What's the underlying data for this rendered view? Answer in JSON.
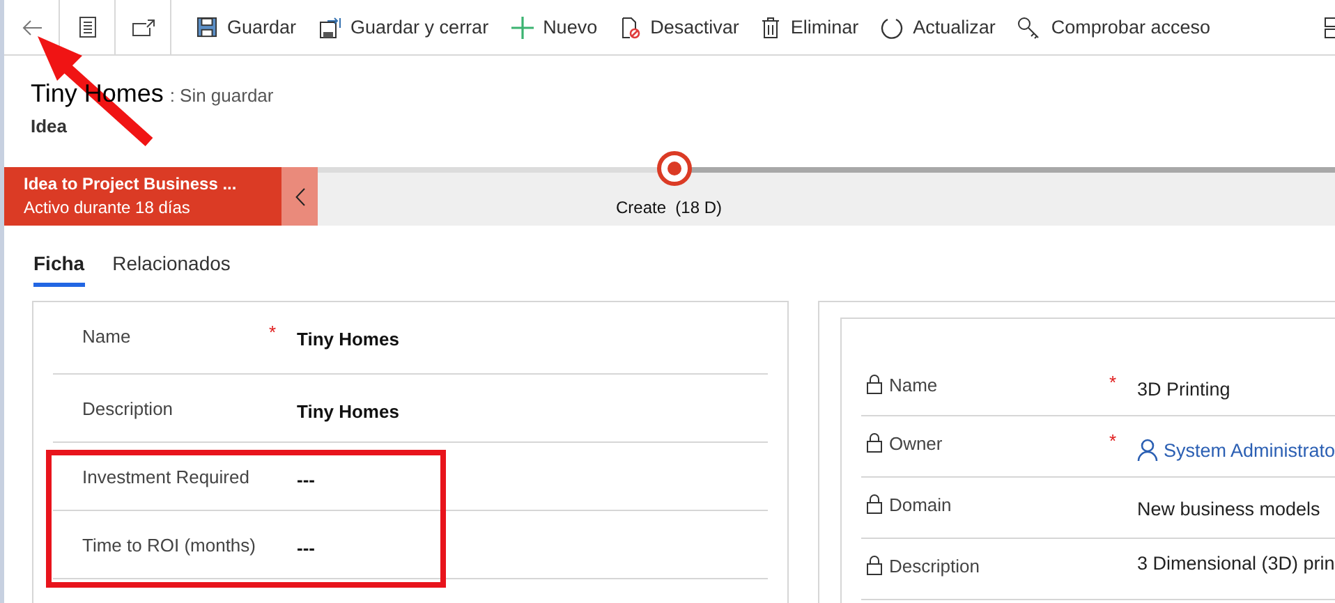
{
  "toolbar": {
    "buttons": [
      {
        "label": "Guardar"
      },
      {
        "label": "Guardar y cerrar"
      },
      {
        "label": "Nuevo"
      },
      {
        "label": "Desactivar"
      },
      {
        "label": "Eliminar"
      },
      {
        "label": "Actualizar"
      },
      {
        "label": "Comprobar acceso"
      }
    ]
  },
  "header": {
    "title": "Tiny Homes",
    "status": ": Sin guardar",
    "entity": "Idea"
  },
  "process": {
    "name": "Idea to Project Business ...",
    "duration": "Activo durante 18 días",
    "stage": "Create",
    "stage_duration": "(18 D)"
  },
  "tabs": [
    {
      "label": "Ficha",
      "selected": true
    },
    {
      "label": "Relacionados",
      "selected": false
    }
  ],
  "left_fields": [
    {
      "label": "Name",
      "required_mark": "*",
      "value": "Tiny Homes"
    },
    {
      "label": "Description",
      "value": "Tiny Homes"
    },
    {
      "label": "Investment Required",
      "value": "---"
    },
    {
      "label": "Time to ROI (months)",
      "value": "---"
    }
  ],
  "right_fields": [
    {
      "label": "Name",
      "required_mark": "*",
      "locked": true,
      "kind": "text",
      "value": "3D Printing"
    },
    {
      "label": "Owner",
      "required_mark": "*",
      "locked": true,
      "kind": "lookup",
      "value": "System Administrato"
    },
    {
      "label": "Domain",
      "locked": true,
      "kind": "text",
      "value": "New business models"
    },
    {
      "label": "Description",
      "locked": true,
      "kind": "text",
      "value": "3 Dimensional (3D) prin"
    }
  ]
}
